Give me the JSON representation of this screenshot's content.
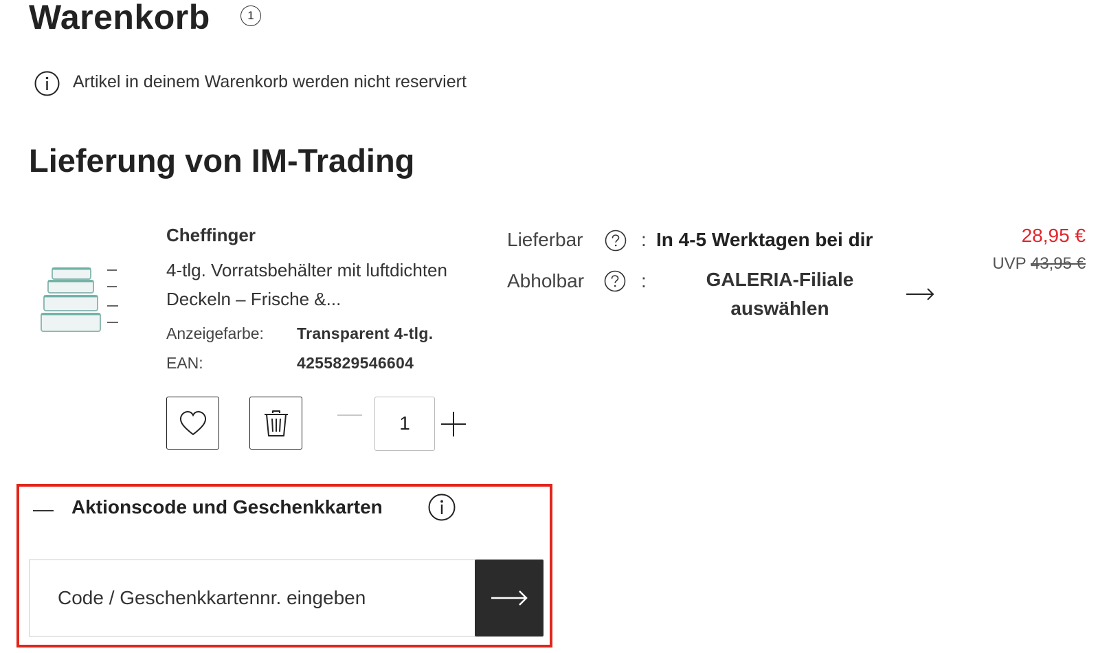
{
  "header": {
    "title": "Warenkorb",
    "item_count": "1"
  },
  "notice": {
    "text": "Artikel in deinem Warenkorb werden nicht reserviert",
    "icon": "info-icon"
  },
  "section": {
    "title": "Lieferung von IM-Trading"
  },
  "product": {
    "brand": "Cheffinger",
    "name": "4-tlg. Vorratsbehälter mit luftdichten Deckeln – Frische &...",
    "attributes": [
      {
        "label": "Anzeigefarbe:",
        "value": "Transparent 4-tlg."
      },
      {
        "label": "EAN:",
        "value": "4255829546604"
      }
    ],
    "quantity": "1",
    "wishlist_icon": "heart-icon",
    "delete_icon": "trash-icon"
  },
  "delivery": {
    "lieferbar_label": "Lieferbar",
    "lieferbar_value": "In 4-5 Werktagen bei dir",
    "abholbar_label": "Abholbar",
    "abholbar_value": "GALERIA-Filiale auswählen",
    "colon": ":"
  },
  "price": {
    "current": "28,95 €",
    "uvp_label": "UVP",
    "uvp_value": "43,95 €",
    "color": "#e0252b"
  },
  "promo": {
    "title": "Aktionscode und Geschenkkarten",
    "placeholder": "Code / Geschenkkartennr. eingeben",
    "highlight_color": "#e1251b"
  }
}
